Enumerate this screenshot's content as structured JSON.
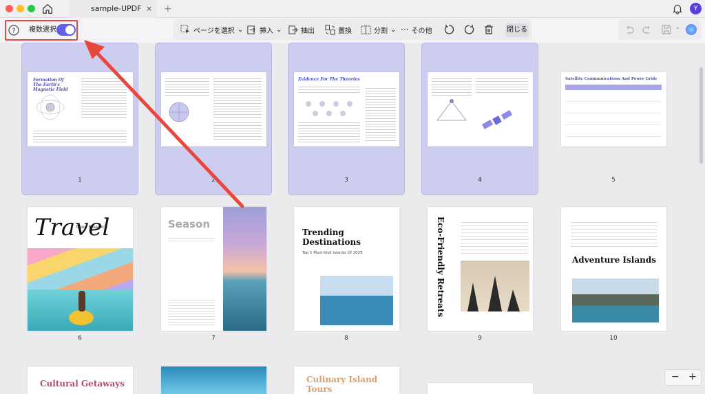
{
  "window": {
    "tab_title": "sample-UPDF",
    "tab_close": "×",
    "tab_add": "+",
    "avatar_initial": "Y"
  },
  "toolbar": {
    "multi_select_label": "複数選択",
    "multi_select_on": true,
    "select_page_label": "ページを選択",
    "insert_label": "挿入",
    "extract_label": "抽出",
    "replace_label": "置換",
    "split_label": "分割",
    "more_label": "その他",
    "close_label": "閉じる"
  },
  "colors": {
    "accent": "#5f5fe8",
    "selected_bg": "#cdcdf0",
    "highlight_red": "#e8473e"
  },
  "pages": [
    {
      "number": "1",
      "selected": true,
      "title": "Formation Of The Earth's Magnetic Field"
    },
    {
      "number": "2",
      "selected": true,
      "title": ""
    },
    {
      "number": "3",
      "selected": true,
      "title": "Evidence For The Theories"
    },
    {
      "number": "4",
      "selected": true,
      "title": ""
    },
    {
      "number": "5",
      "selected": false,
      "title": "Satellite Communications And Power Grids"
    },
    {
      "number": "6",
      "selected": false,
      "title": "Travel",
      "subtitle": "Trend Research"
    },
    {
      "number": "7",
      "selected": false,
      "title": "Season"
    },
    {
      "number": "8",
      "selected": false,
      "title": "Trending Destinations",
      "subtitle": "Top 5 Must-Visit Islands Of 2025"
    },
    {
      "number": "9",
      "selected": false,
      "title": "Eco-Friendly Retreats"
    },
    {
      "number": "10",
      "selected": false,
      "title": "Adventure Islands"
    },
    {
      "number": "",
      "selected": false,
      "title": "Cultural Getaways"
    },
    {
      "number": "",
      "selected": false,
      "title": ""
    },
    {
      "number": "",
      "selected": false,
      "title": "Culinary Island Tours"
    }
  ],
  "zoom": {
    "minus": "−",
    "plus": "+"
  }
}
